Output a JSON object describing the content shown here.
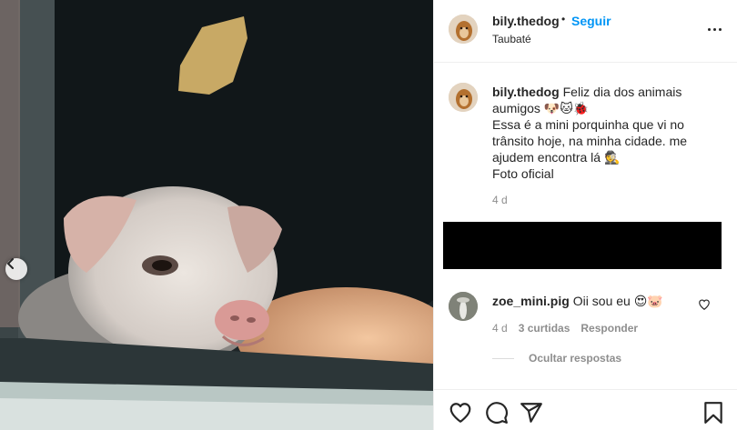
{
  "post": {
    "image": {
      "subject": "mini pig looking out of a car window",
      "prev_icon": "chevron-left-icon"
    },
    "header": {
      "username": "bily.thedog",
      "dot": "•",
      "follow_label": "Seguir",
      "location": "Taubaté",
      "more_icon": "more-horizontal-icon"
    },
    "caption": {
      "username": "bily.thedog",
      "lines": [
        "Feliz dia dos animais aumigos 🐶🐱🐞",
        "Essa é a mini porquinha que vi no trânsito hoje, na minha cidade. me ajudem encontra lá 🕵",
        "Foto oficial"
      ],
      "time": "4 d"
    },
    "reply": {
      "username": "zoe_mini.pig",
      "text": "Oii sou eu 😍🐷",
      "time": "4 d",
      "likes": "3 curtidas",
      "reply_label": "Responder",
      "hide_label": "Ocultar respostas"
    },
    "actions": [
      "heart-icon",
      "comment-icon",
      "share-icon",
      "bookmark-icon"
    ]
  }
}
